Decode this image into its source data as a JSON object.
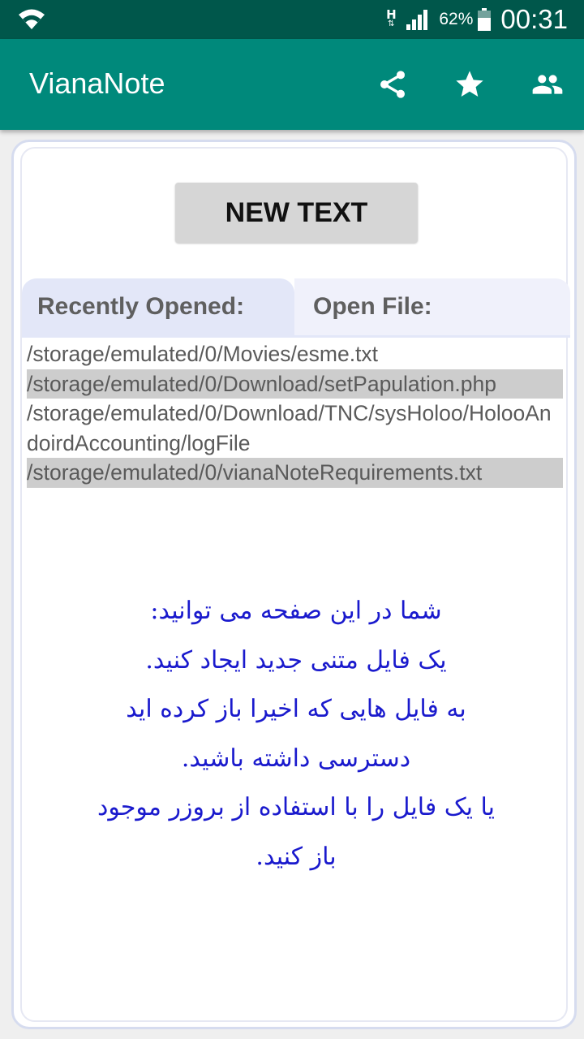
{
  "status_bar": {
    "network_type": "H",
    "battery_percent": "62%",
    "time": "00:31"
  },
  "app_bar": {
    "title": "VianaNote",
    "actions": [
      {
        "icon": "share-icon"
      },
      {
        "icon": "star-icon"
      },
      {
        "icon": "people-icon"
      }
    ]
  },
  "main": {
    "new_text_label": "NEW TEXT",
    "tabs": [
      {
        "label": "Recently Opened:",
        "selected": true
      },
      {
        "label": "Open File:",
        "selected": false
      }
    ],
    "recent_files": [
      {
        "path": "/storage/emulated/0/Movies/esme.txt",
        "shaded": false
      },
      {
        "path": "/storage/emulated/0/Download/setPapulation.php",
        "shaded": true
      },
      {
        "path": "/storage/emulated/0/Download/TNC/sysHoloo/HolooAndoirdAccounting/logFile",
        "shaded": false
      },
      {
        "path": "/storage/emulated/0/vianaNoteRequirements.txt",
        "shaded": true
      }
    ],
    "help_lines": [
      "شما در این صفحه می توانید:",
      "یک فایل متنی جدید ایجاد کنید.",
      "به فایل هایی که اخیرا باز کرده اید",
      "دسترسی داشته باشید.",
      "یا یک فایل را با استفاده از بروزر موجود",
      "باز کنید."
    ]
  },
  "colors": {
    "status_bar": "#00574b",
    "app_bar": "#00897b",
    "help_text": "#1a1acd",
    "shaded_row": "#cdcdcd"
  }
}
